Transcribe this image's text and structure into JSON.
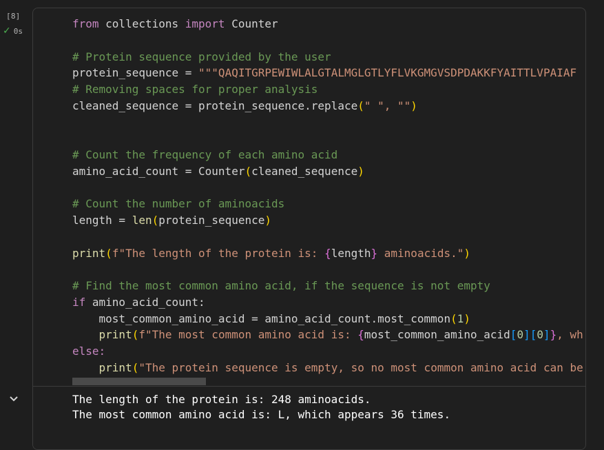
{
  "cell": {
    "execution_count": "[8]",
    "run_time": "0s",
    "code_lines": {
      "l1": [
        "from",
        " collections ",
        "import",
        " Counter"
      ],
      "l3": "# Protein sequence provided by the user",
      "l4": [
        "protein_sequence = ",
        "\"\"\"QAQITGRPEWIWLALGTALMGLGTLYFLVKGMGVSDPDAKKFYAITTLVPAIAF"
      ],
      "l5": "# Removing spaces for proper analysis",
      "l6": [
        "cleaned_sequence = protein_sequence.replace",
        "(",
        "\" \", \"\"",
        ")"
      ],
      "l9": "# Count the frequency of each amino acid",
      "l10": [
        "amino_acid_count = Counter",
        "(",
        "cleaned_sequence",
        ")"
      ],
      "l12": "# Count the number of aminoacids",
      "l13": [
        "length = ",
        "len",
        "(",
        "protein_sequence",
        ")"
      ],
      "l15": [
        "print",
        "(",
        "f\"The length of the protein is: ",
        "{",
        "length",
        "}",
        " aminoacids.\"",
        ")"
      ],
      "l17": "# Find the most common amino acid, if the sequence is not empty",
      "l18": [
        "if",
        " amino_acid_count:"
      ],
      "l19": [
        "    most_common_amino_acid = amino_acid_count.most_common",
        "(",
        "1",
        ")"
      ],
      "l20": [
        "    ",
        "print",
        "(",
        "f\"The most common amino acid is: ",
        "{",
        "most_common_amino_acid",
        "[",
        "0",
        "]",
        "[",
        "0",
        "]",
        "}",
        ", wh"
      ],
      "l21": "else:",
      "l22": [
        "    ",
        "print",
        "(",
        "\"The protein sequence is empty, so no most common amino acid can be"
      ]
    },
    "output": [
      "The length of the protein is: 248 aminoacids.",
      "The most common amino acid is: L, which appears 36 times."
    ]
  },
  "colors": {
    "keyword": "#c586c0",
    "comment": "#6a9955",
    "string": "#ce9178",
    "function": "#dcdcaa",
    "success": "#4caf50"
  },
  "icons": {
    "status": "check-icon",
    "collapse": "chevron-down-icon"
  }
}
